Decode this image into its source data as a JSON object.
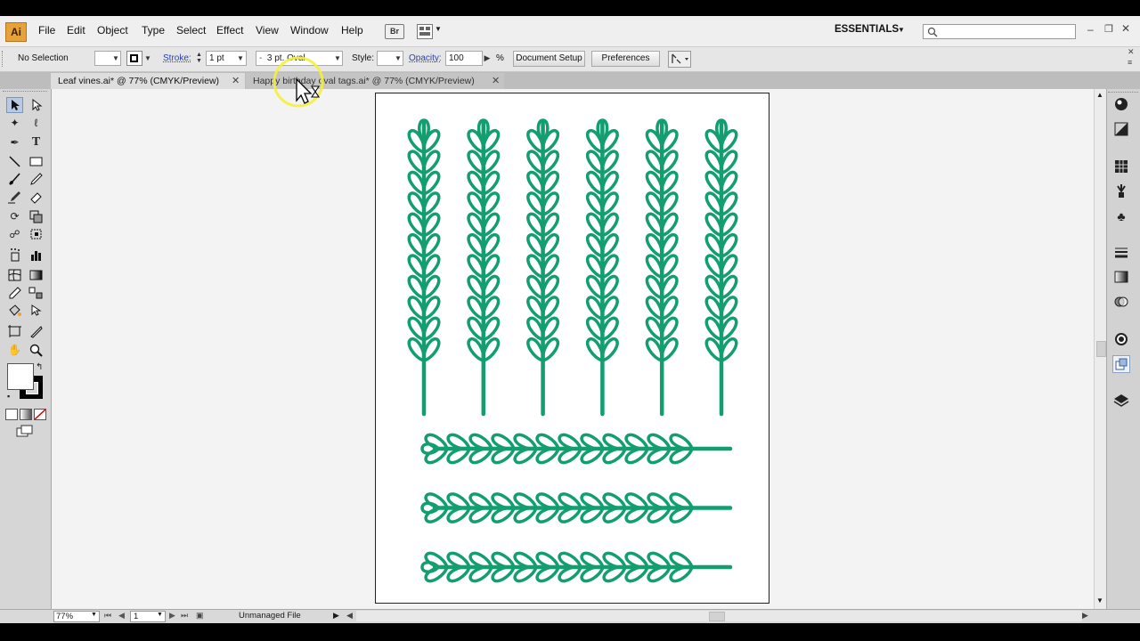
{
  "app": {
    "logo_text": "Ai"
  },
  "menu": {
    "items": [
      "File",
      "Edit",
      "Object",
      "Type",
      "Select",
      "Effect",
      "View",
      "Window",
      "Help"
    ],
    "bridge_label": "Br",
    "workspace": "ESSENTIALS",
    "search_placeholder": ""
  },
  "control": {
    "selection": "No Selection",
    "stroke_label": "Stroke:",
    "stroke_weight": "1 pt",
    "brush": "3 pt. Oval",
    "style_label": "Style:",
    "opacity_label": "Opacity:",
    "opacity_value": "100",
    "opacity_unit": "%",
    "doc_setup": "Document Setup",
    "preferences": "Preferences"
  },
  "tabs": [
    {
      "label": "Leaf vines.ai* @ 77% (CMYK/Preview)",
      "active": true
    },
    {
      "label": "Happy birthday oval tags.ai* @ 77% (CMYK/Preview)",
      "active": false
    }
  ],
  "status": {
    "zoom": "77%",
    "artboard": "1",
    "info": "Unmanaged File"
  },
  "colors": {
    "leaf": "#129e6f",
    "accent_cursor": "#f4ef3c"
  },
  "vines": {
    "vertical_count": 6,
    "horizontal_count": 3
  }
}
